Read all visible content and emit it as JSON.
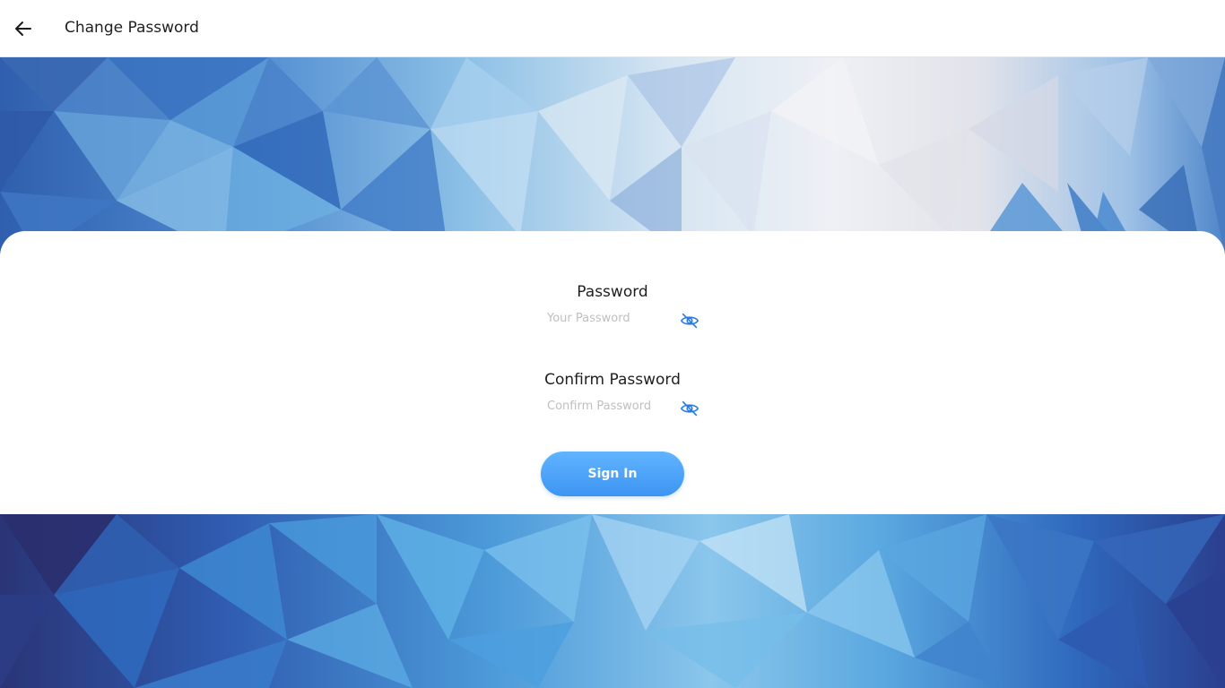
{
  "header": {
    "title": "Change Password",
    "back_icon": "arrow-left-icon"
  },
  "form": {
    "password": {
      "label": "Password",
      "placeholder": "Your Password",
      "value": "",
      "toggle_icon": "eye-off-icon"
    },
    "confirm_password": {
      "label": "Confirm Password",
      "placeholder": "Confirm Password",
      "value": "",
      "toggle_icon": "eye-off-icon"
    },
    "submit_label": "Sign In"
  },
  "colors": {
    "accent": "#3c95f2",
    "icon_blue": "#2b7be4",
    "text": "#1f1f1f",
    "placeholder": "#bfbfbf"
  }
}
